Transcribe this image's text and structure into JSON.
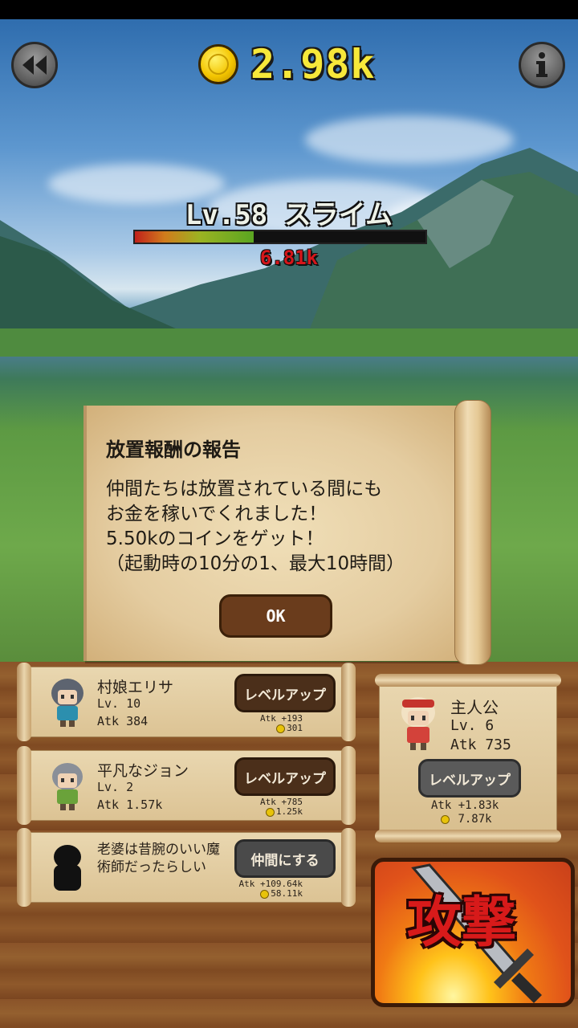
{
  "hud": {
    "coins": "2.98k"
  },
  "enemy": {
    "name": "Lv.58 スライム",
    "hp_text": "6.81k",
    "hp_fraction": 0.41
  },
  "dialog": {
    "title": "放置報酬の報告",
    "body": "仲間たちは放置されている間にも\nお金を稼いでくれました！\n5.50kのコインをゲット！\n（起動時の10分の1、最大10時間）",
    "ok_label": "OK"
  },
  "party": [
    {
      "name": "村娘エリサ",
      "level": "Lv. 10",
      "atk": "Atk 384",
      "button": "レベルアップ",
      "atk_gain": "Atk +193",
      "cost": "301"
    },
    {
      "name": "平凡なジョン",
      "level": "Lv. 2",
      "atk": "Atk 1.57k",
      "button": "レベルアップ",
      "atk_gain": "Atk +785",
      "cost": "1.25k"
    },
    {
      "name": "老婆は昔腕のいい魔\n術師だったらしい",
      "level": "",
      "atk": "",
      "button": "仲間にする",
      "atk_gain": "Atk +109.64k",
      "cost": "58.11k"
    }
  ],
  "hero": {
    "name": "主人公",
    "level": "Lv. 6",
    "atk": "Atk 735",
    "button": "レベルアップ",
    "atk_gain": "Atk +1.83k",
    "cost": "7.87k"
  },
  "attack": {
    "label": "攻撃"
  },
  "colors": {
    "coin_text": "#f7e83a",
    "hp_text": "#d6161b",
    "attack_label": "#d71a1a"
  },
  "icons": {
    "back": "rewind-icon",
    "info": "info-icon",
    "coin": "gold-coin-icon",
    "attack": "sword-icon"
  }
}
